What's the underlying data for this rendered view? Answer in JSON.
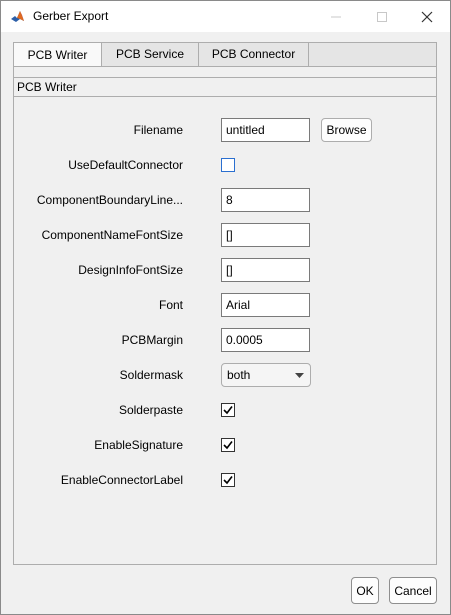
{
  "window": {
    "title": "Gerber Export"
  },
  "tabs": [
    {
      "label": "PCB Writer",
      "active": true
    },
    {
      "label": "PCB Service",
      "active": false
    },
    {
      "label": "PCB Connector",
      "active": false
    }
  ],
  "panel": {
    "header": "PCB Writer",
    "rows": {
      "filename": {
        "label": "Filename",
        "value": "untitled",
        "browse_label": "Browse"
      },
      "use_default_connector": {
        "label": "UseDefaultConnector",
        "checked": false
      },
      "component_boundary_line": {
        "label": "ComponentBoundaryLine...",
        "value": "8"
      },
      "component_name_font_size": {
        "label": "ComponentNameFontSize",
        "value": "[]"
      },
      "design_info_font_size": {
        "label": "DesignInfoFontSize",
        "value": "[]"
      },
      "font": {
        "label": "Font",
        "value": "Arial"
      },
      "pcb_margin": {
        "label": "PCBMargin",
        "value": "0.0005"
      },
      "soldermask": {
        "label": "Soldermask",
        "value": "both"
      },
      "solderpaste": {
        "label": "Solderpaste",
        "checked": true
      },
      "enable_signature": {
        "label": "EnableSignature",
        "checked": true
      },
      "enable_connector_label": {
        "label": "EnableConnectorLabel",
        "checked": true
      }
    }
  },
  "buttons": {
    "ok": "OK",
    "cancel": "Cancel"
  },
  "colors": {
    "checkbox_border": "#2a6fd0",
    "accent": "#0078d7"
  }
}
